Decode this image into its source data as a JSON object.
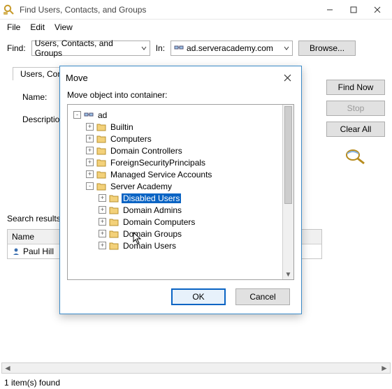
{
  "window": {
    "title": "Find Users, Contacts, and Groups",
    "menus": [
      "File",
      "Edit",
      "View"
    ]
  },
  "search": {
    "find_label": "Find:",
    "find_value": "Users, Contacts, and Groups",
    "in_label": "In:",
    "in_value": "ad.serveracademy.com",
    "browse_label": "Browse..."
  },
  "tab": {
    "label": "Users, Contacts, and Groups"
  },
  "fields": {
    "name_label": "Name:",
    "description_label": "Description:"
  },
  "side_buttons": {
    "find_now": "Find Now",
    "stop": "Stop",
    "clear_all": "Clear All"
  },
  "search_results_label": "Search results:",
  "results": {
    "header": "Name",
    "rows": [
      {
        "name": "Paul Hill"
      }
    ]
  },
  "status": "1 item(s) found",
  "dialog": {
    "title": "Move",
    "instruction": "Move object into container:",
    "ok": "OK",
    "cancel": "Cancel",
    "tree": [
      {
        "depth": 0,
        "expander": "-",
        "icon": "domain",
        "label": "ad"
      },
      {
        "depth": 1,
        "expander": "+",
        "icon": "folder",
        "label": "Builtin"
      },
      {
        "depth": 1,
        "expander": "+",
        "icon": "folder",
        "label": "Computers"
      },
      {
        "depth": 1,
        "expander": "+",
        "icon": "folder",
        "label": "Domain Controllers"
      },
      {
        "depth": 1,
        "expander": "+",
        "icon": "folder",
        "label": "ForeignSecurityPrincipals"
      },
      {
        "depth": 1,
        "expander": "+",
        "icon": "folder",
        "label": "Managed Service Accounts"
      },
      {
        "depth": 1,
        "expander": "-",
        "icon": "folder",
        "label": "Server Academy"
      },
      {
        "depth": 2,
        "expander": "+",
        "icon": "folder",
        "label": "Disabled Users",
        "selected": true
      },
      {
        "depth": 2,
        "expander": "+",
        "icon": "folder",
        "label": "Domain Admins"
      },
      {
        "depth": 2,
        "expander": "+",
        "icon": "folder",
        "label": "Domain Computers"
      },
      {
        "depth": 2,
        "expander": "+",
        "icon": "folder",
        "label": "Domain Groups"
      },
      {
        "depth": 2,
        "expander": "+",
        "icon": "folder",
        "label": "Domain Users"
      }
    ]
  }
}
